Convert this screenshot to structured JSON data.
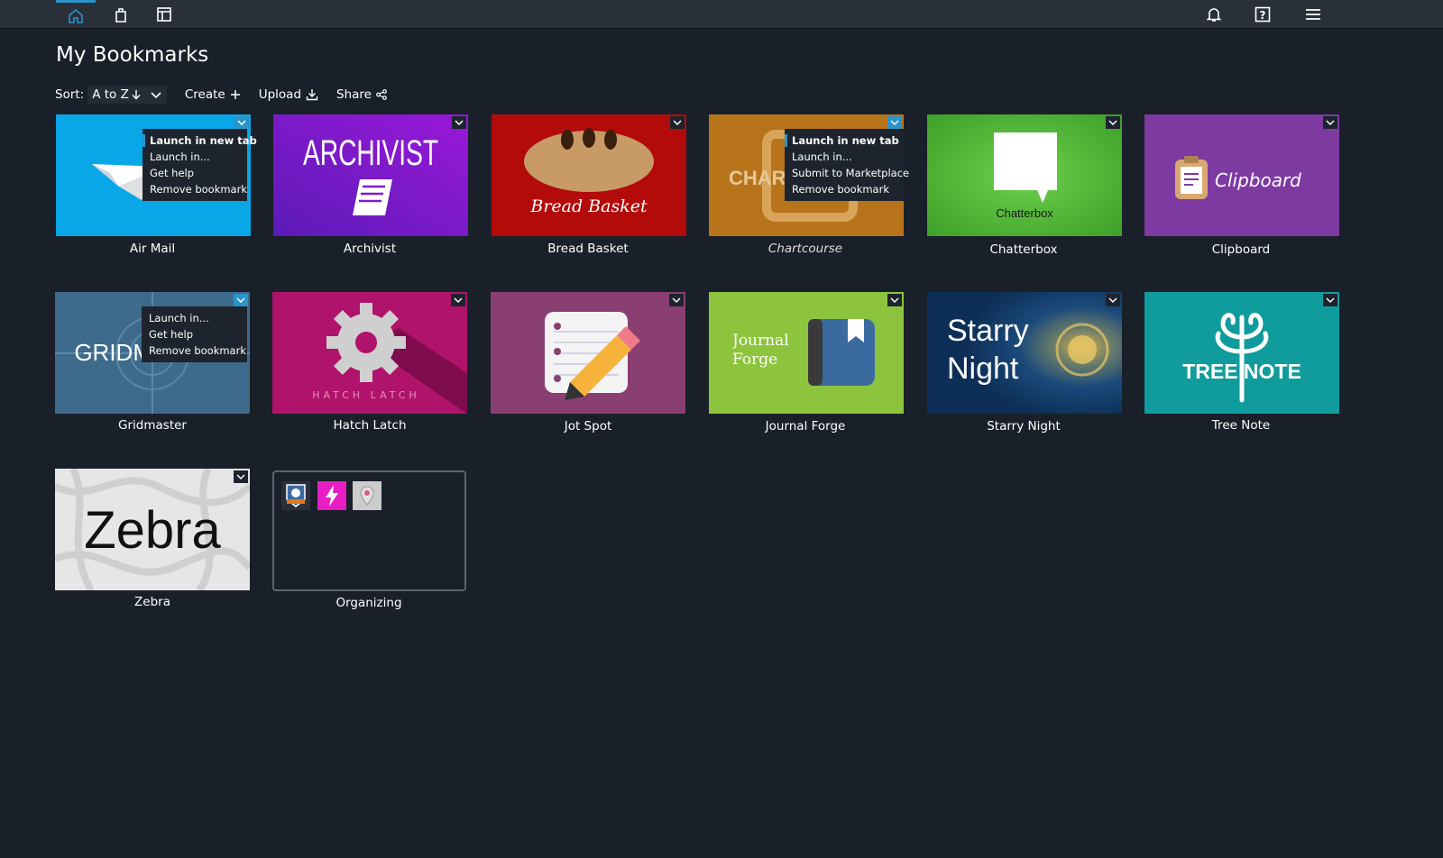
{
  "page": {
    "title": "My Bookmarks"
  },
  "toolbar": {
    "sort_label": "Sort:",
    "sort_value": "A to Z",
    "create_label": "Create",
    "upload_label": "Upload",
    "share_label": "Share"
  },
  "tiles": [
    {
      "name": "Air Mail",
      "color": "#0aa7e8"
    },
    {
      "name": "Archivist",
      "color": "#7a1bd1",
      "art_text": "ARCHIVIST"
    },
    {
      "name": "Bread Basket",
      "color": "#b30a0a",
      "art_text": "Bread Basket"
    },
    {
      "name": "Chartcourse",
      "color": "#b8741a",
      "art_text": "CHAR"
    },
    {
      "name": "Chatterbox",
      "color": "#52b83a",
      "art_text": "Chatterbox"
    },
    {
      "name": "Clipboard",
      "color": "#7d3aa0",
      "art_text": "Clipboard"
    },
    {
      "name": "Gridmaster",
      "color": "#3e6b8c",
      "art_text": "GRIDMASTER"
    },
    {
      "name": "Hatch Latch",
      "color": "#b0136b",
      "art_text": "HATCH LATCH"
    },
    {
      "name": "Jot Spot",
      "color": "#8a3f72"
    },
    {
      "name": "Journal Forge",
      "color": "#8cc43e",
      "art_text": "Journal Forge"
    },
    {
      "name": "Starry Night",
      "color": "#0f3a66",
      "art_text": "Starry Night"
    },
    {
      "name": "Tree Note",
      "color": "#109c9c",
      "art_text": "TREE NOTE"
    },
    {
      "name": "Zebra",
      "color": "#e6e6e6",
      "art_text": "Zebra"
    }
  ],
  "folder": {
    "name": "Organizing",
    "mini_colors": [
      "#2b2f3a",
      "#e61ec4",
      "#cccccc"
    ]
  },
  "menus": {
    "air_mail": [
      "Launch in new tab",
      "Launch in...",
      "Get help",
      "Remove bookmark"
    ],
    "chartcourse": [
      "Launch in new tab",
      "Launch in...",
      "Submit to Marketplace",
      "Remove bookmark"
    ],
    "gridmaster": [
      "Launch in...",
      "Get help",
      "Remove bookmark"
    ]
  },
  "colors": {
    "accent": "#2a94c9",
    "background": "#1a2029",
    "topbar": "#2a3039"
  }
}
